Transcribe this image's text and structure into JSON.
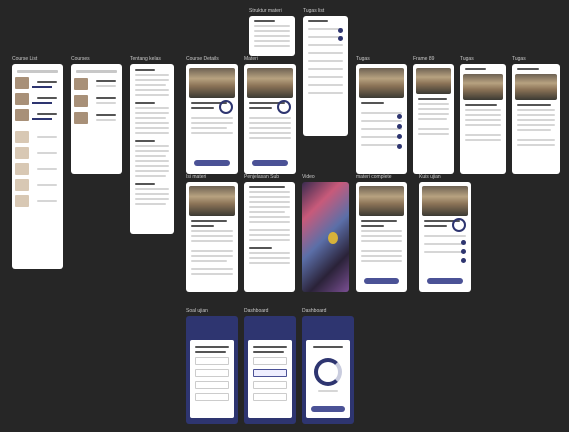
{
  "canvas": {
    "background": "#262626",
    "accent": "#2e3570"
  },
  "frames": {
    "course_list": "Course List",
    "courses": "Courses",
    "tentang_kelas": "Tentang kelas",
    "course_details": "Course Details",
    "materi": "Materi",
    "struktur_materi": "Struktur materi",
    "tugas_list": "Tugas list",
    "tugas": "Tugas",
    "frame_89": "Frame 89",
    "tugas_2": "Tugas",
    "tugas_3": "Tugas",
    "isi_materi": "Isi materi",
    "penjelasan_sub": "Penjelasan Sub",
    "video": "Video",
    "materi_complete": "materi complete",
    "kuis_ujian": "Kuis ujian",
    "soal_ujian": "Soal ujian",
    "dashboard": "Dashboard",
    "dashboard_2": "Dashboard"
  }
}
